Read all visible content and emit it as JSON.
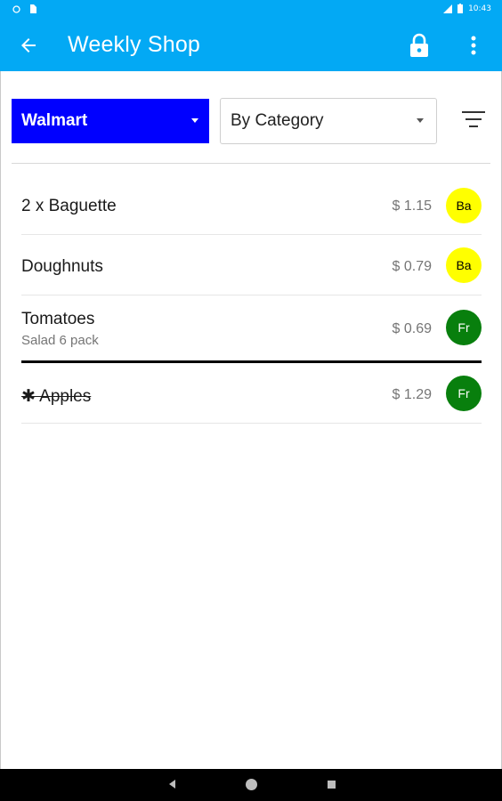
{
  "status_bar": {
    "time": "10:43",
    "icons": [
      "notification-icon",
      "sim-icon",
      "signal-icon",
      "battery-icon"
    ]
  },
  "app_bar": {
    "title": "Weekly Shop",
    "icons": [
      "back-arrow-icon",
      "lock-icon",
      "more-vert-icon"
    ],
    "color": "#03a9f4"
  },
  "controls": {
    "store": "Walmart",
    "store_color": "#0000ff",
    "sort": "By Category",
    "filter_icon": "filter-list-icon"
  },
  "items": [
    {
      "name": "2 x Baguette",
      "note": "",
      "price": "$ 1.15",
      "badge": "Ba",
      "badge_color": "#ffff00",
      "badge_text_color": "#000000",
      "checked": false
    },
    {
      "name": "Doughnuts",
      "note": "",
      "price": "$ 0.79",
      "badge": "Ba",
      "badge_color": "#ffff00",
      "badge_text_color": "#000000",
      "checked": false
    },
    {
      "name": "Tomatoes",
      "note": "Salad 6 pack",
      "price": "$ 0.69",
      "badge": "Fr",
      "badge_color": "#087f0d",
      "badge_text_color": "#ffffff",
      "checked": false
    },
    {
      "name": "✱ Apples",
      "note": "",
      "price": "$ 1.29",
      "badge": "Fr",
      "badge_color": "#087f0d",
      "badge_text_color": "#ffffff",
      "checked": true
    }
  ],
  "nav_bar": {
    "icons": [
      "nav-back-icon",
      "nav-home-icon",
      "nav-recents-icon"
    ]
  }
}
